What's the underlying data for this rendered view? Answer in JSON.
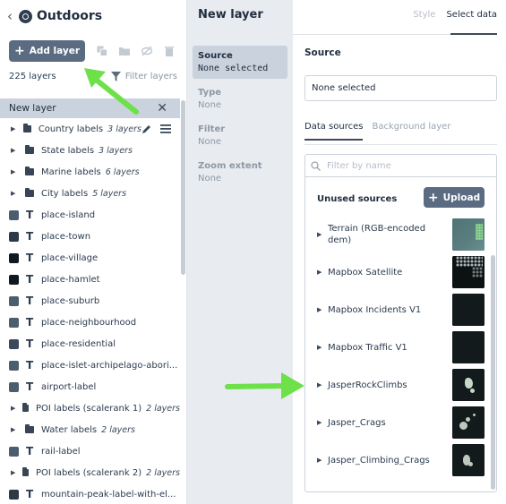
{
  "sidebar": {
    "style_name": "Outdoors",
    "add_layer_label": "Add layer",
    "layer_count": "225 layers",
    "filter_label": "Filter layers",
    "selected_layer": "New layer",
    "layers": [
      {
        "kind": "group",
        "name": "Country labels",
        "count": "3 layers",
        "actions": true
      },
      {
        "kind": "group",
        "name": "State labels",
        "count": "3 layers"
      },
      {
        "kind": "group",
        "name": "Marine labels",
        "count": "6 layers"
      },
      {
        "kind": "group",
        "name": "City labels",
        "count": "5 layers"
      },
      {
        "kind": "symbol",
        "name": "place-island",
        "color": "#4c5d6e"
      },
      {
        "kind": "symbol",
        "name": "place-town",
        "color": "#2c3a48"
      },
      {
        "kind": "symbol",
        "name": "place-village",
        "color": "#101820"
      },
      {
        "kind": "symbol",
        "name": "place-hamlet",
        "color": "#101820"
      },
      {
        "kind": "symbol",
        "name": "place-suburb",
        "color": "#4c5d6e"
      },
      {
        "kind": "symbol",
        "name": "place-neighbourhood",
        "color": "#4c5d6e"
      },
      {
        "kind": "symbol",
        "name": "place-residential",
        "color": "#3a4a5a"
      },
      {
        "kind": "symbol",
        "name": "place-islet-archipelago-abori...",
        "color": "#4c5d6e"
      },
      {
        "kind": "symbol",
        "name": "airport-label",
        "color": "#4c5d6e"
      },
      {
        "kind": "group",
        "name": "POI labels (scalerank 1)",
        "count": "2 layers"
      },
      {
        "kind": "group",
        "name": "Water labels",
        "count": "2 layers"
      },
      {
        "kind": "symbol",
        "name": "rail-label",
        "color": "#4c5d6e"
      },
      {
        "kind": "group",
        "name": "POI labels (scalerank 2)",
        "count": "2 layers"
      },
      {
        "kind": "symbol",
        "name": "mountain-peak-label-with-el...",
        "color": "#2c3a48"
      }
    ]
  },
  "middle": {
    "title": "New layer",
    "items": [
      {
        "label": "Source",
        "value": "None selected",
        "active": true
      },
      {
        "label": "Type",
        "value": "None"
      },
      {
        "label": "Filter",
        "value": "None"
      },
      {
        "label": "Zoom extent",
        "value": "None"
      }
    ]
  },
  "right": {
    "tab_style": "Style",
    "tab_select_data": "Select data",
    "source_label": "Source",
    "source_value": "None selected",
    "tab_data_sources": "Data sources",
    "tab_background": "Background layer",
    "search_placeholder": "Filter by name",
    "unused_label": "Unused sources",
    "upload_label": "Upload",
    "sources": [
      {
        "name": "Terrain (RGB-encoded dem)",
        "thumb": "terrain"
      },
      {
        "name": "Mapbox Satellite",
        "thumb": "satellite"
      },
      {
        "name": "Mapbox Incidents V1",
        "thumb": "dark"
      },
      {
        "name": "Mapbox Traffic V1",
        "thumb": "dark"
      },
      {
        "name": "JasperRockClimbs",
        "thumb": "points"
      },
      {
        "name": "Jasper_Crags",
        "thumb": "points2"
      },
      {
        "name": "Jasper_Climbing_Crags",
        "thumb": "points3"
      }
    ]
  }
}
